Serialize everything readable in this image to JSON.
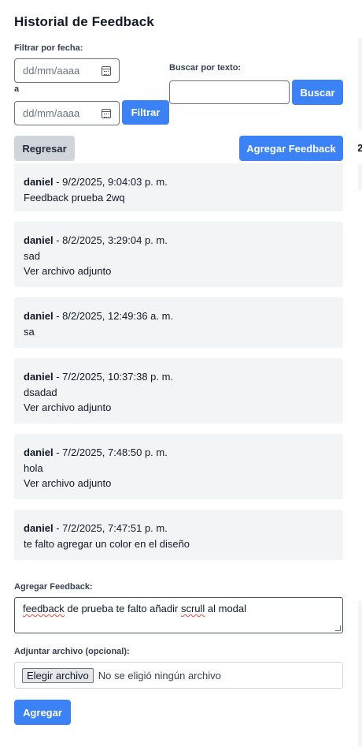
{
  "title": "Historial de Feedback",
  "filter": {
    "date_label": "Filtrar por fecha:",
    "date_placeholder": "dd/mm/aaaa",
    "separator": "a",
    "filter_button": "Filtrar"
  },
  "search": {
    "label": "Buscar por texto:",
    "value": "",
    "button": "Buscar"
  },
  "actions": {
    "back": "Regresar",
    "add_feedback": "Agregar Feedback"
  },
  "entries": [
    {
      "author": "daniel",
      "date": " - 9/2/2025, 9:04:03 p. m.",
      "text": "Feedback prueba 2wq",
      "attachment": ""
    },
    {
      "author": "daniel",
      "date": " - 8/2/2025, 3:29:04 p. m.",
      "text": "sad",
      "attachment": "Ver archivo adjunto"
    },
    {
      "author": "daniel",
      "date": " - 8/2/2025, 12:49:36 a. m.",
      "text": "sa",
      "attachment": ""
    },
    {
      "author": "daniel",
      "date": " - 7/2/2025, 10:37:38 p. m.",
      "text": "dsadad",
      "attachment": "Ver archivo adjunto"
    },
    {
      "author": "daniel",
      "date": " - 7/2/2025, 7:48:50 p. m.",
      "text": "hola",
      "attachment": "Ver archivo adjunto"
    },
    {
      "author": "daniel",
      "date": " - 7/2/2025, 7:47:51 p. m.",
      "text": "te falto agregar un color en el diseño",
      "attachment": ""
    }
  ],
  "form": {
    "feedback_label": "Agregar Feedback:",
    "feedback_value_parts": [
      "feedback",
      " de prueba te falto añadir ",
      "scrull",
      " al modal"
    ],
    "file_label": "Adjuntar archivo (opcional):",
    "file_button": "Elegir archivo",
    "file_status": "No se eligió ningún archivo",
    "submit": "Agregar"
  },
  "background": {
    "edge_text": "2"
  },
  "colors": {
    "accent": "#3b82f6",
    "entry_bg": "#f3f4f6",
    "secondary_button": "#d1d5db"
  }
}
